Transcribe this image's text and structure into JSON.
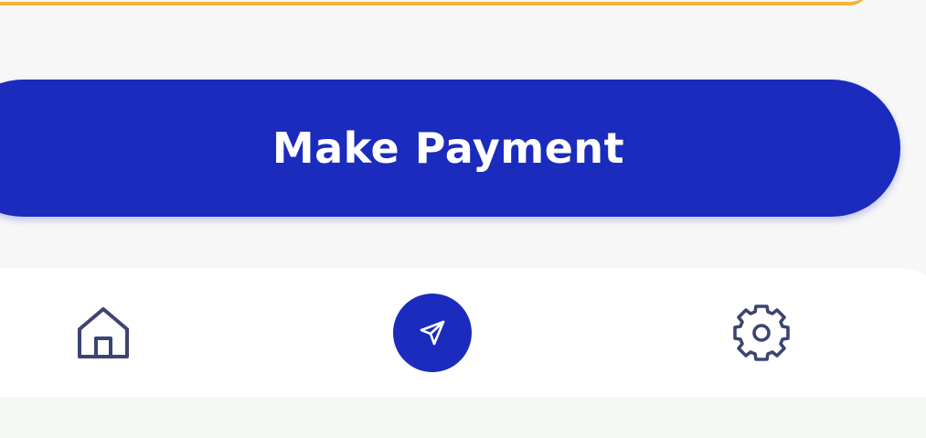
{
  "payment": {
    "button_label": "Make Payment"
  },
  "nav": {
    "items": [
      {
        "icon": "home-icon",
        "active": false
      },
      {
        "icon": "send-icon",
        "active": true
      },
      {
        "icon": "gear-icon",
        "active": false
      }
    ]
  },
  "colors": {
    "primary": "#1a2bbd",
    "accent_border": "#f2b33a",
    "icon": "#3d4470",
    "background": "#f7f7f8",
    "nav_background": "#ffffff",
    "bottom_strip": "#f3f8f4"
  }
}
